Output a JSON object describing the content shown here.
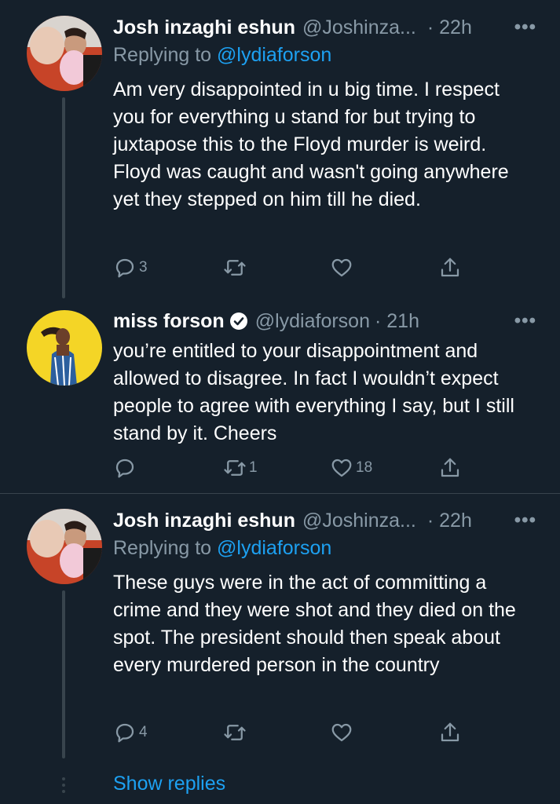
{
  "tweets": [
    {
      "name": "Josh inzaghi eshun",
      "handle": "@Joshinza...",
      "time": "· 22h",
      "replying_label": "Replying to",
      "replying_to": "@lydiaforson",
      "text": "Am very disappointed in u big time. I respect you for everything u stand for but trying to juxtapose this to the Floyd murder is weird. Floyd was caught and wasn't going anywhere yet they stepped on him till he died.",
      "reply_count": "3",
      "retweet_count": "",
      "like_count": ""
    },
    {
      "name": "miss forson",
      "handle": "@lydiaforson",
      "time": "· 21h",
      "verified": true,
      "text": "you’re entitled to your disappointment and allowed to disagree. In fact I wouldn’t expect people to agree with everything I say, but I still stand by it. Cheers",
      "reply_count": "",
      "retweet_count": "1",
      "like_count": "18"
    },
    {
      "name": "Josh inzaghi eshun",
      "handle": "@Joshinza...",
      "time": "· 22h",
      "replying_label": "Replying to",
      "replying_to": "@lydiaforson",
      "text": "These guys were in the act of committing a crime and they were shot and they died on the spot. The president should then speak about every murdered person in the country",
      "reply_count": "4",
      "retweet_count": "",
      "like_count": ""
    }
  ],
  "show_replies": "Show replies",
  "colors": {
    "background": "#15202b",
    "secondary_text": "#8899a6",
    "accent": "#1da1f2",
    "divider": "#38444d"
  },
  "icons": {
    "reply": "reply-icon",
    "retweet": "retweet-icon",
    "like": "heart-icon",
    "share": "share-icon",
    "more": "more-icon",
    "verified": "verified-badge-icon"
  }
}
